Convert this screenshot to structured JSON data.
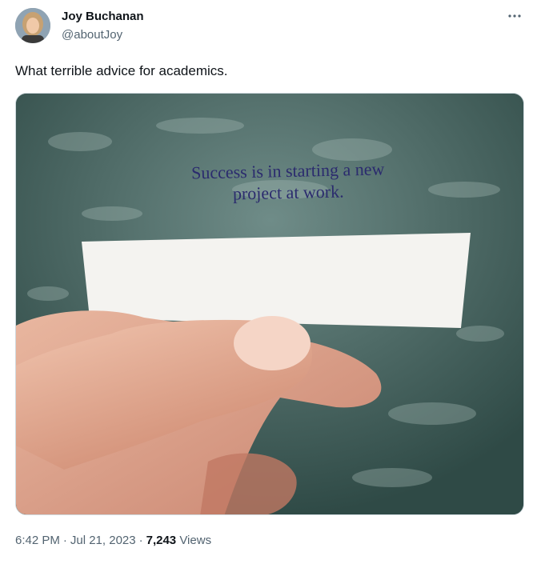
{
  "author": {
    "name": "Joy Buchanan",
    "handle": "@aboutJoy"
  },
  "tweet": {
    "text": "What terrible advice for academics."
  },
  "media": {
    "fortune_line1": "Success is in starting a new",
    "fortune_line2": "project at work."
  },
  "meta": {
    "time": "6:42 PM",
    "date": "Jul 21, 2023",
    "separator": "·",
    "views_count": "7,243",
    "views_label": "Views"
  },
  "icons": {
    "more": "more-horizontal-icon"
  },
  "colors": {
    "text_primary": "#0f1419",
    "text_secondary": "#536471",
    "border": "#cfd9de"
  }
}
